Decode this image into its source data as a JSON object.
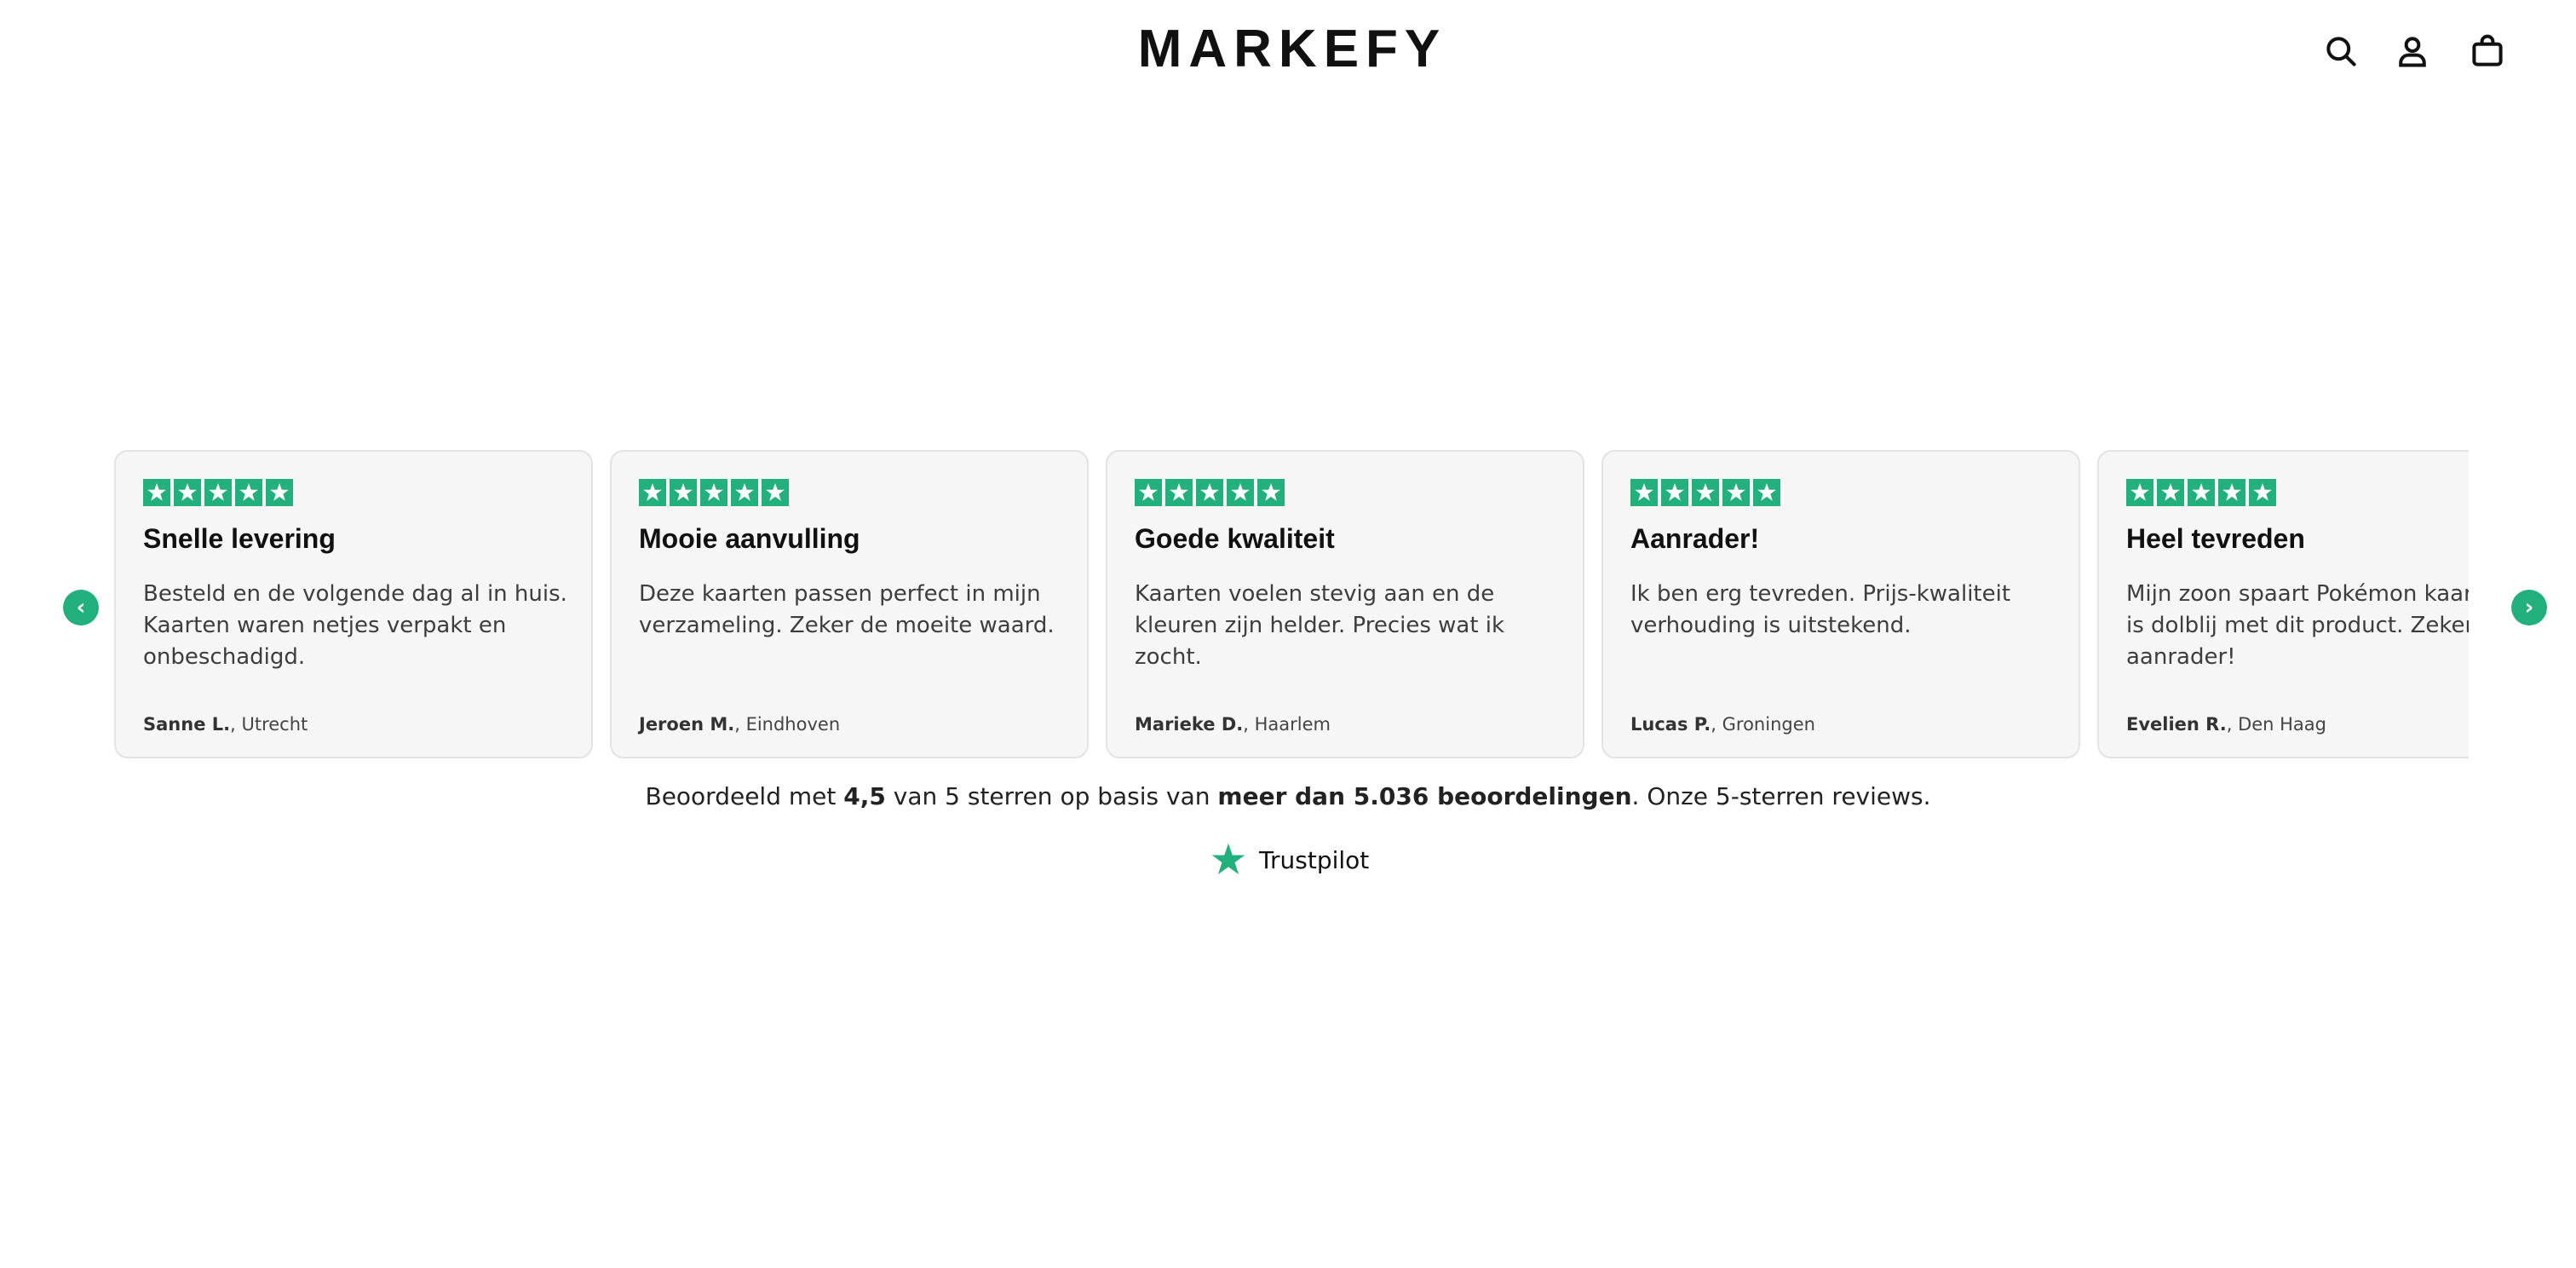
{
  "header": {
    "logo": "MARKEFY",
    "icons": [
      "search-icon",
      "account-icon",
      "cart-icon"
    ]
  },
  "colors": {
    "accent": "#22b07d",
    "card_bg": "#f6f6f6",
    "card_border": "#e3e3e3"
  },
  "carousel": {
    "prev_label": "‹",
    "next_label": "›",
    "reviews": [
      {
        "rating": 5,
        "title": "Snelle levering",
        "text": "Besteld en de volgende dag al in huis. Kaarten waren netjes verpakt en onbeschadigd.",
        "author": "Sanne L.",
        "location": ", Utrecht"
      },
      {
        "rating": 5,
        "title": "Mooie aanvulling",
        "text": "Deze kaarten passen perfect in mijn verzameling. Zeker de moeite waard.",
        "author": "Jeroen M.",
        "location": ", Eindhoven"
      },
      {
        "rating": 5,
        "title": "Goede kwaliteit",
        "text": "Kaarten voelen stevig aan en de kleuren zijn helder. Precies wat ik zocht.",
        "author": "Marieke D.",
        "location": ", Haarlem"
      },
      {
        "rating": 5,
        "title": "Aanrader!",
        "text": "Ik ben erg tevreden. Prijs-kwaliteit verhouding is uitstekend.",
        "author": "Lucas P.",
        "location": ", Groningen"
      },
      {
        "rating": 5,
        "title": "Heel tevreden",
        "text": "Mijn zoon spaart Pokémon kaarten en is dolblij met dit product. Zeker een aanrader!",
        "author": "Evelien R.",
        "location": ", Den Haag"
      }
    ]
  },
  "summary": {
    "part1": "Beoordeeld met ",
    "rating": "4,5",
    "part2": " van 5 sterren op basis van ",
    "count": "meer dan 5.036 beoordelingen",
    "part3": ". Onze 5-sterren reviews."
  },
  "trustpilot": {
    "name": "Trustpilot",
    "icon": "trustpilot-star-icon"
  }
}
